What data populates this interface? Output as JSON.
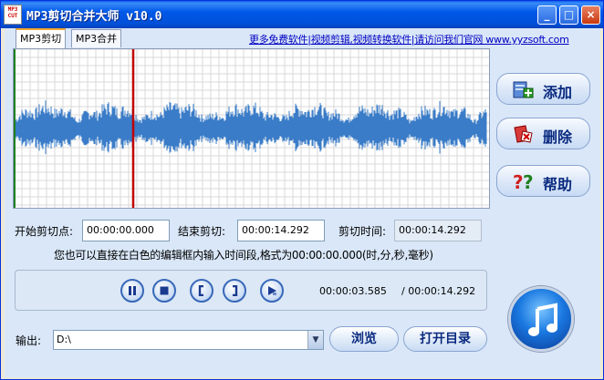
{
  "window": {
    "icon_text": "MP3 CUT",
    "title": "MP3剪切合并大师 v10.0"
  },
  "tabs": [
    {
      "label": "MP3剪切"
    },
    {
      "label": "MP3合并"
    }
  ],
  "top_link": "更多免费软件|视频剪辑,视频转换软件|请访问我们官网 www.yyzsoft.com",
  "waveform": {
    "playhead_color": "#c00000",
    "wave_color": "#3a7cc8",
    "grid_color": "#d8d8d8",
    "start_marker_color": "#208020"
  },
  "side_buttons": {
    "add": "添加",
    "delete": "删除",
    "help": "帮助"
  },
  "fields": {
    "start_label": "开始剪切点:",
    "start_value": "00:00:00.000",
    "end_label": "结束剪切:",
    "end_value": "00:00:14.292",
    "duration_label": "剪切时间:",
    "duration_value": "00:00:14.292"
  },
  "hint": "您也可以直接在白色的编辑框内输入时间段,格式为00:00:00.000(时,分,秒,毫秒)",
  "player": {
    "current_time": "00:00:03.585",
    "total_time": "/ 00:00:14.292"
  },
  "output": {
    "label": "输出:",
    "path": "D:\\",
    "browse": "浏览",
    "open_dir": "打开目录"
  }
}
